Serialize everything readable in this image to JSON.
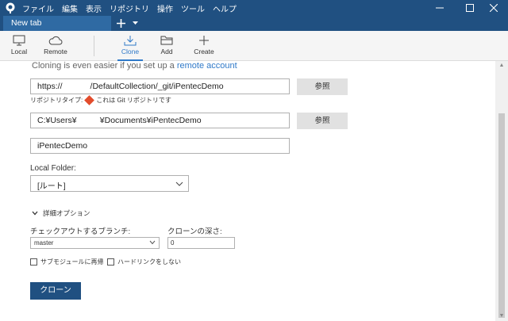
{
  "titlebar": {
    "menu": [
      "ファイル",
      "編集",
      "表示",
      "リポジトリ",
      "操作",
      "ツール",
      "ヘルプ"
    ],
    "icons": {
      "app": "sourcetree-icon",
      "minimize": "minimize-icon",
      "maximize": "maximize-icon",
      "close": "close-icon"
    }
  },
  "tabs": [
    {
      "label": "New tab"
    }
  ],
  "toolbar": {
    "local": "Local",
    "remote": "Remote",
    "clone": "Clone",
    "add": "Add",
    "create": "Create",
    "active": "clone"
  },
  "clone": {
    "hint_text": "Cloning is even easier if you set up a ",
    "hint_link": "remote account",
    "source_url": "https://            /DefaultCollection/_git/iPentecDemo",
    "browse_label": "参照",
    "repo_type_prefix": "リポジトリタイプ:",
    "repo_type_text": "これは Git リポジトリです",
    "destination_path": "C:¥Users¥          ¥Documents¥iPentecDemo",
    "name": "iPentecDemo",
    "local_folder_label": "Local Folder:",
    "local_folder_value": "[ルート]",
    "advanced_label": "詳細オプション",
    "checkout_branch_label": "チェックアウトするブランチ:",
    "checkout_branch_value": "master",
    "clone_depth_label": "クローンの深さ:",
    "clone_depth_value": "0",
    "recurse_submodules_label": "サブモジュールに再帰",
    "no_hardlinks_label": "ハードリンクをしない",
    "clone_button": "クローン"
  },
  "colors": {
    "titlebar": "#205081",
    "accent": "#2f79c8",
    "git_badge": "#e24c2c"
  }
}
